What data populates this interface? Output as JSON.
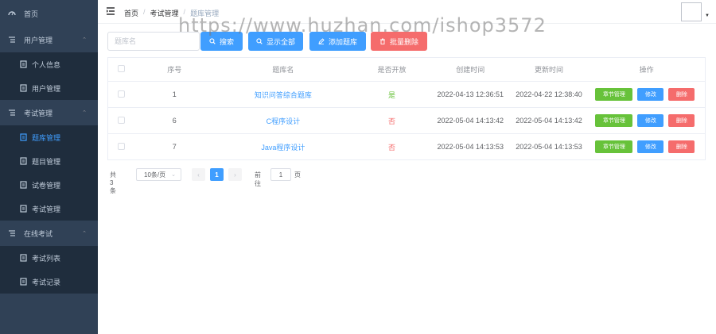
{
  "sidebar": {
    "home": "首页",
    "groups": [
      {
        "title": "用户管理",
        "items": [
          "个人信息",
          "用户管理"
        ]
      },
      {
        "title": "考试管理",
        "items": [
          "题库管理",
          "题目管理",
          "试卷管理",
          "考试管理"
        ]
      },
      {
        "title": "在线考试",
        "items": [
          "考试列表",
          "考试记录"
        ]
      }
    ],
    "active_item": "题库管理"
  },
  "header": {
    "breadcrumb": [
      "首页",
      "考试管理",
      "题库管理"
    ]
  },
  "toolbar": {
    "search_placeholder": "题库名",
    "search_label": "搜索",
    "show_all_label": "显示全部",
    "add_label": "添加题库",
    "batch_delete_label": "批量删除"
  },
  "table": {
    "columns": [
      "序号",
      "题库名",
      "是否开放",
      "创建时间",
      "更新时间",
      "操作"
    ],
    "rows": [
      {
        "id": "1",
        "name": "知识问答综合题库",
        "open": "是",
        "created": "2022-04-13 12:36:51",
        "updated": "2022-04-22 12:38:40"
      },
      {
        "id": "6",
        "name": "C程序设计",
        "open": "否",
        "created": "2022-05-04 14:13:42",
        "updated": "2022-05-04 14:13:42"
      },
      {
        "id": "7",
        "name": "Java程序设计",
        "open": "否",
        "created": "2022-05-04 14:13:53",
        "updated": "2022-05-04 14:13:53"
      }
    ],
    "actions": {
      "chapter": "章节管理",
      "edit": "修改",
      "delete": "删除"
    }
  },
  "pagination": {
    "total": "共 3 条",
    "page_size": "10条/页",
    "current_page": "1",
    "goto_label": "前往",
    "goto_value": "1",
    "page_suffix": "页"
  },
  "watermark": "https://www.huzhan.com/ishop3572",
  "colors": {
    "sidebar_bg": "#304156",
    "primary": "#409eff",
    "danger": "#f56c6c",
    "success": "#67c23a"
  }
}
